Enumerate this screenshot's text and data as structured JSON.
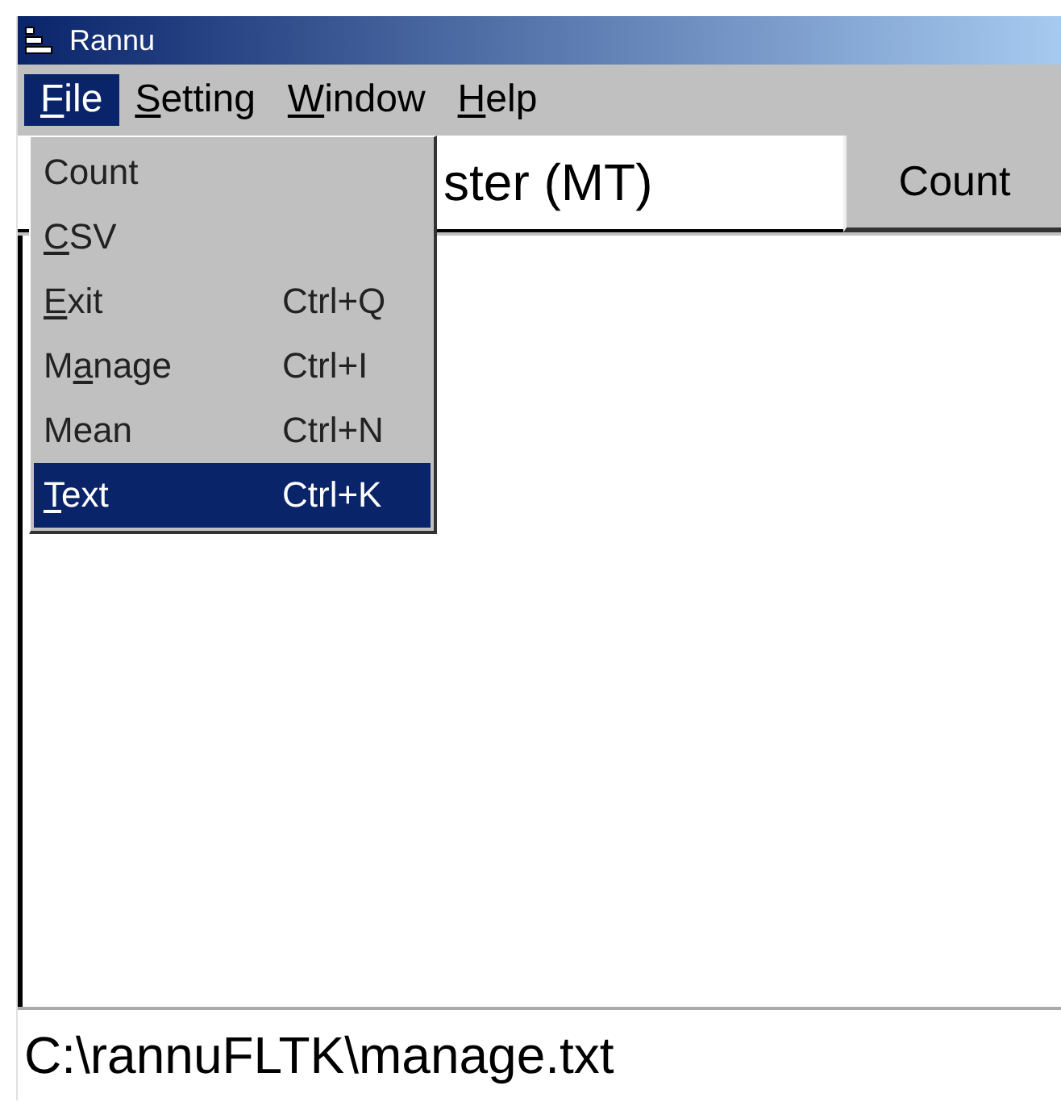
{
  "window": {
    "title": "Rannu"
  },
  "menu_bar": [
    {
      "label": {
        "key": "F",
        "after": "ile"
      },
      "selected": true
    },
    {
      "label": {
        "key": "S",
        "after": "etting"
      },
      "selected": false
    },
    {
      "label": {
        "key": "W",
        "after": "indow"
      },
      "selected": false
    },
    {
      "label": {
        "key": "H",
        "after": "elp"
      },
      "selected": false
    }
  ],
  "header": {
    "text": "ster (MT)"
  },
  "count_button": {
    "label": "Count"
  },
  "file_menu": [
    {
      "label": {
        "before": "Count"
      },
      "selected": false
    },
    {
      "label": {
        "key": "C",
        "after": "SV"
      },
      "selected": false
    },
    {
      "label": {
        "key": "E",
        "after": "xit"
      },
      "shortcut": "Ctrl+Q",
      "selected": false
    },
    {
      "label": {
        "before": "M",
        "key": "a",
        "after": "nage"
      },
      "shortcut": "Ctrl+I",
      "selected": false
    },
    {
      "label": {
        "before": "Mean"
      },
      "shortcut": "Ctrl+N",
      "selected": false
    },
    {
      "label": {
        "key": "T",
        "after": "ext"
      },
      "shortcut": "Ctrl+K",
      "selected": true
    }
  ],
  "status_bar": {
    "text": "C:\\rannuFLTK\\manage.txt"
  }
}
